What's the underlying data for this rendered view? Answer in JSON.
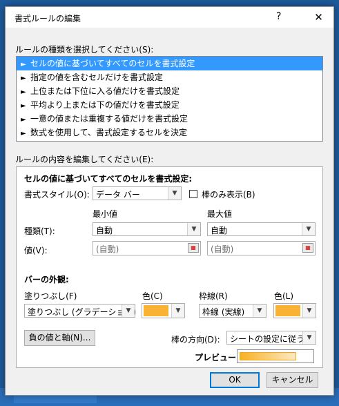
{
  "dialog": {
    "title": "書式ルールの編集",
    "help": "?",
    "close": "✕"
  },
  "rule_type": {
    "label": "ルールの種類を選択してください(S):",
    "items": [
      "セルの値に基づいてすべてのセルを書式設定",
      "指定の値を含むセルだけを書式設定",
      "上位または下位に入る値だけを書式設定",
      "平均より上または下の値だけを書式設定",
      "一意の値または重複する値だけを書式設定",
      "数式を使用して、書式設定するセルを決定"
    ],
    "selected_index": 0
  },
  "rule_desc": {
    "label": "ルールの内容を編集してください(E):",
    "heading": "セルの値に基づいてすべてのセルを書式設定:",
    "format_style_label": "書式スタイル(O):",
    "format_style_value": "データ バー",
    "bar_only_label": "棒のみ表示(B)",
    "bar_only_checked": false,
    "min_label": "最小値",
    "max_label": "最大値",
    "type_label": "種類(T):",
    "value_label": "値(V):",
    "min_type": "自動",
    "max_type": "自動",
    "min_value_placeholder": "(自動)",
    "max_value_placeholder": "(自動)",
    "bar_appearance_heading": "バーの外観:",
    "fill_label": "塗りつぶし(F)",
    "fill_value": "塗りつぶし (グラデーション)",
    "fill_color_label": "色(C)",
    "fill_color": "#f9b233",
    "border_label": "枠線(R)",
    "border_value": "枠線 (実線)",
    "border_color_label": "色(L)",
    "border_color": "#f9b233",
    "neg_axis_button": "負の値と軸(N)...",
    "direction_label": "棒の方向(D):",
    "direction_value": "シートの設定に従う",
    "preview_label": "プレビュー:"
  },
  "footer": {
    "ok": "OK",
    "cancel": "キャンセル"
  }
}
